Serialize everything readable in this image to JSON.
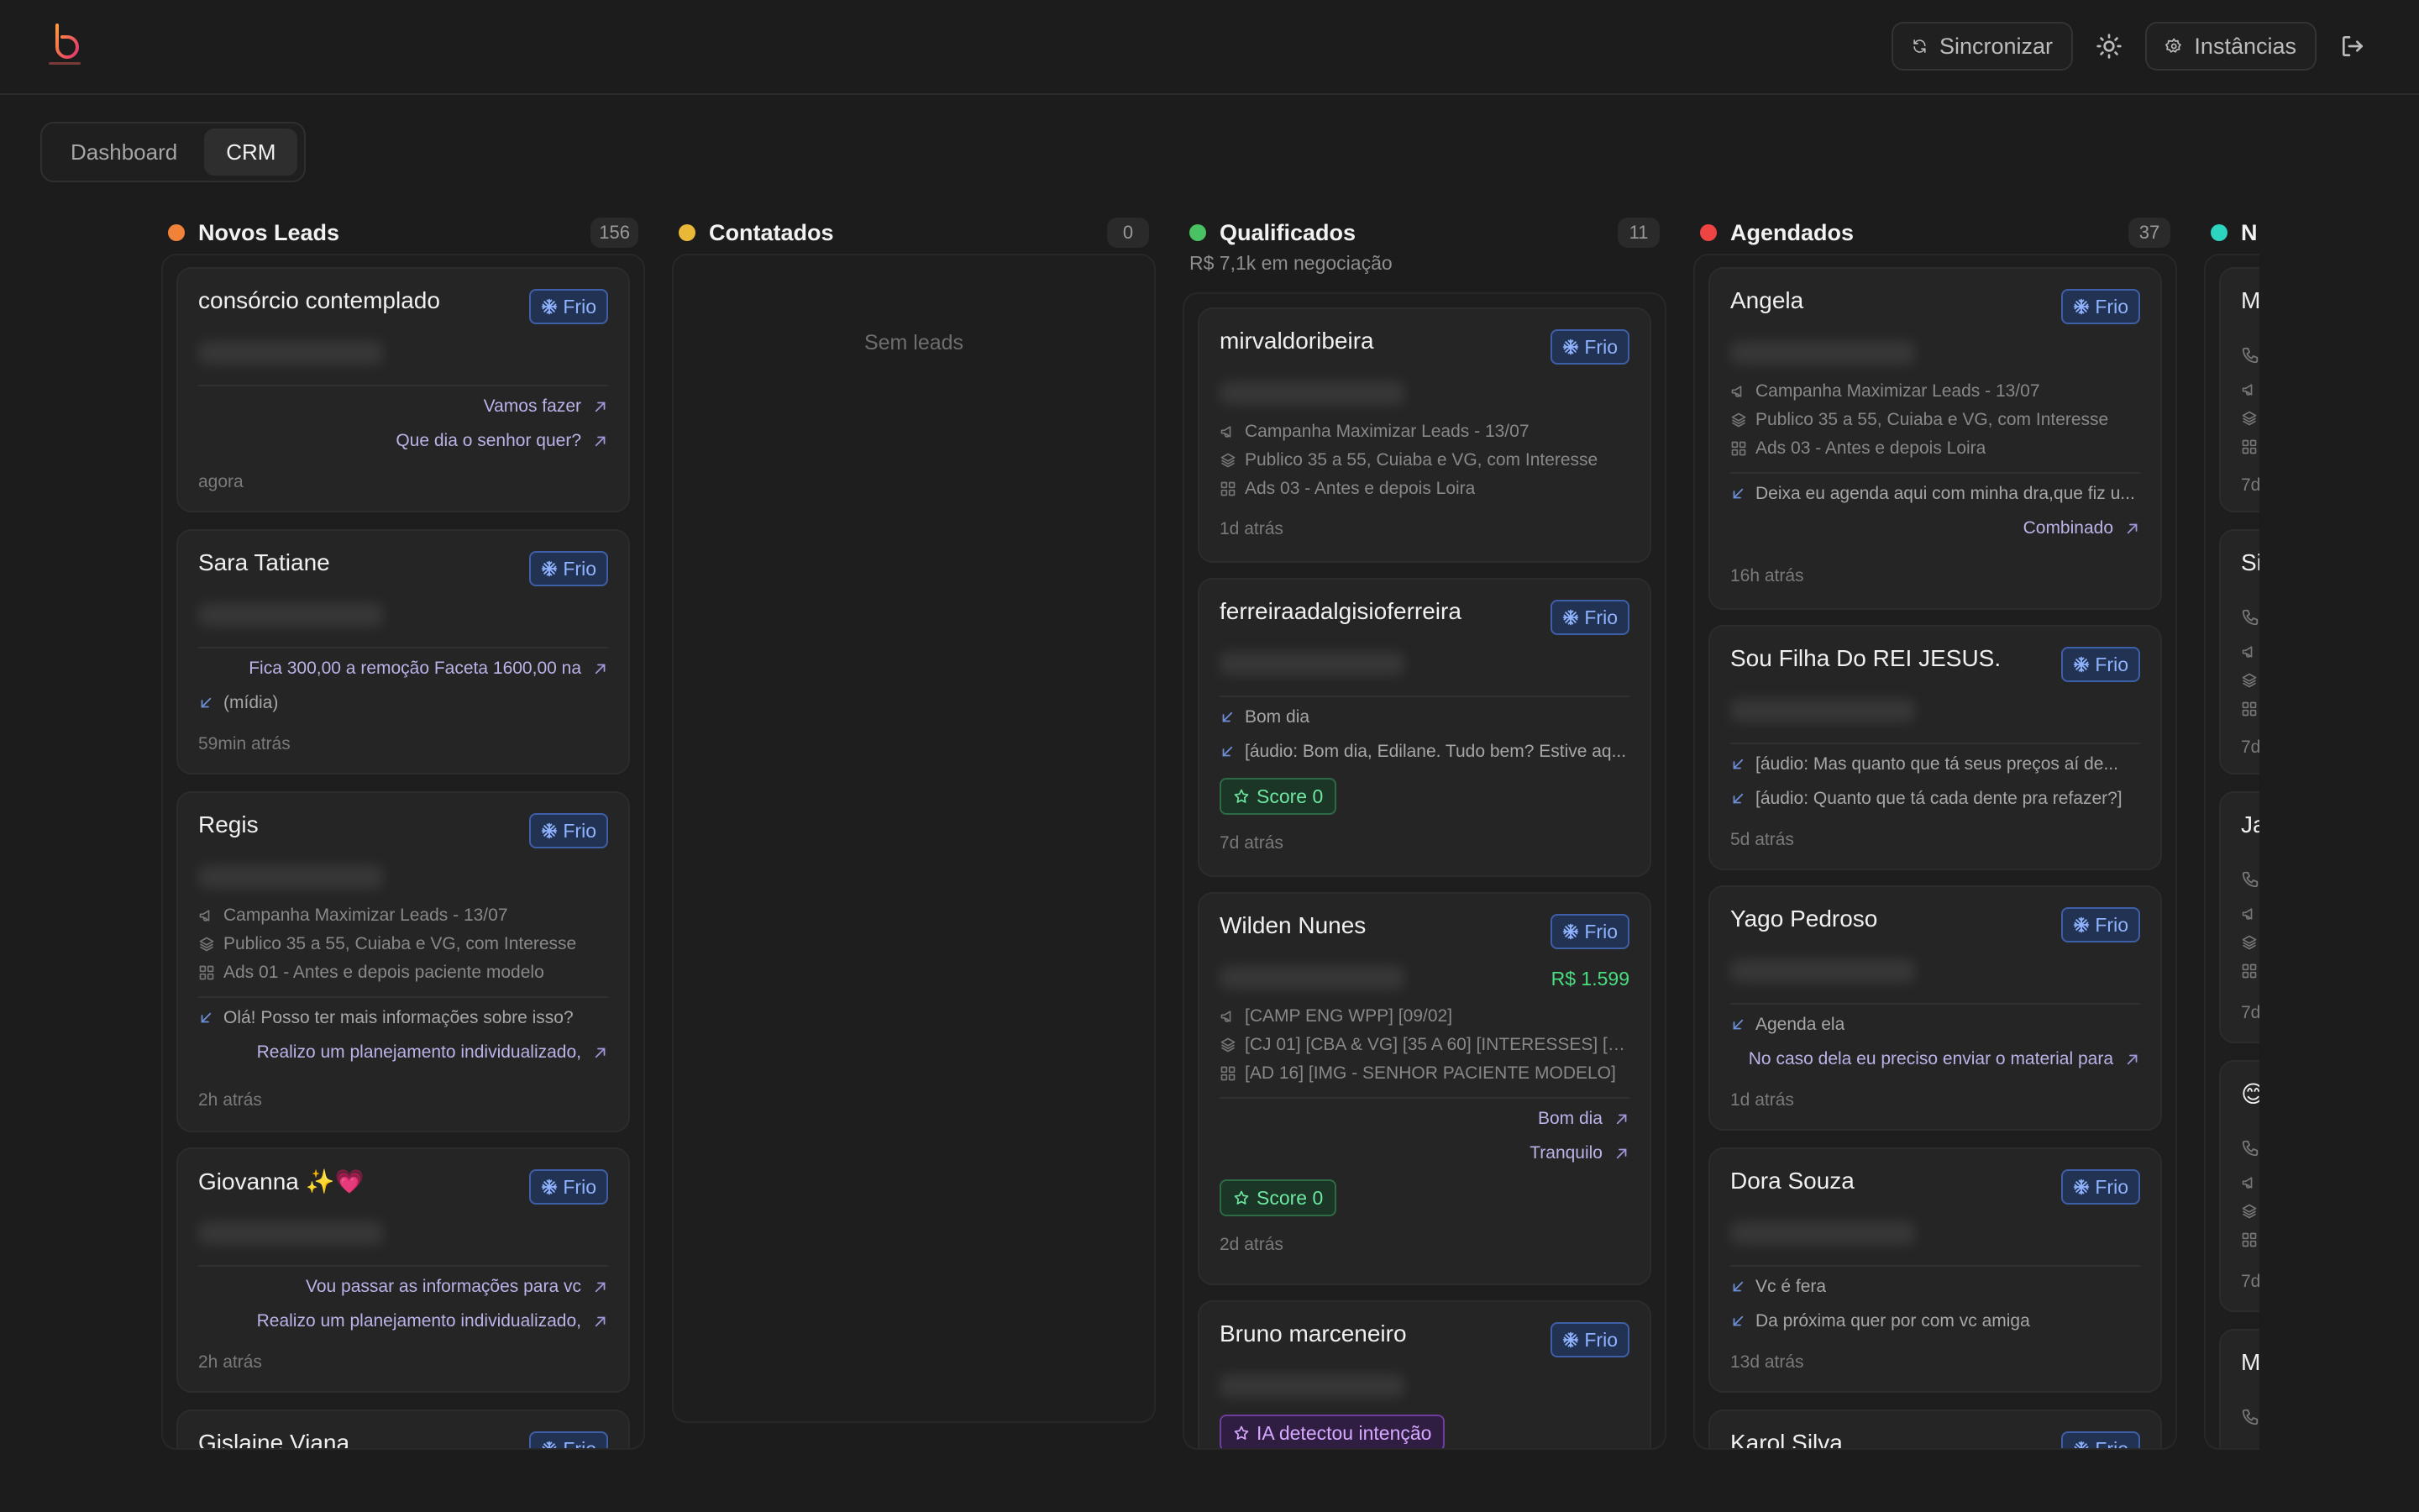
{
  "header": {
    "sync_label": "Sincronizar",
    "instances_label": "Instâncias"
  },
  "tabs": [
    {
      "label": "Dashboard",
      "active": false
    },
    {
      "label": "CRM",
      "active": true
    }
  ],
  "colors": {
    "novos": "#f0823a",
    "contatados": "#eab838",
    "qualificados": "#4ac264",
    "agendados": "#ef4444",
    "next": "#2dd4bf",
    "frio": "#8fb3ff",
    "score": "#6ee7a0",
    "ia": "#d7a8ff"
  },
  "columns": {
    "novos": {
      "title": "Novos Leads",
      "count": "156",
      "cards": [
        {
          "name": "consórcio contemplado",
          "badge": "Frio",
          "out1": "Vamos fazer",
          "out2": "Que dia o senhor quer?",
          "time": "agora"
        },
        {
          "name": "Sara Tatiane",
          "badge": "Frio",
          "out1": "Fica 300,00 a remoção Faceta 1600,00 na",
          "in1": "(mídia)",
          "time": "59min atrás"
        },
        {
          "name": "Regis",
          "badge": "Frio",
          "campaign": "Campanha Maximizar Leads - 13/07",
          "audience": "Publico 35 a 55, Cuiaba e VG, com Interesse",
          "ad": "Ads 01 - Antes e depois paciente modelo",
          "in1": "Olá! Posso ter mais informações sobre isso?",
          "out1": "Realizo um planejamento individualizado,",
          "time": "2h atrás"
        },
        {
          "name": "Giovanna ✨💗",
          "badge": "Frio",
          "out1": "Vou passar as informações para vc",
          "out2": "Realizo um planejamento individualizado,",
          "time": "2h atrás"
        },
        {
          "name": "Gislaine Viana",
          "badge": "Frio"
        }
      ]
    },
    "contatados": {
      "title": "Contatados",
      "count": "0",
      "empty": "Sem leads"
    },
    "qualificados": {
      "title": "Qualificados",
      "count": "11",
      "subtitle": "R$ 7,1k em negociação",
      "cards": [
        {
          "name": "mirvaldoribeira",
          "badge": "Frio",
          "campaign": "Campanha Maximizar Leads - 13/07",
          "audience": "Publico 35 a 55, Cuiaba e VG, com Interesse",
          "ad": "Ads 03 - Antes e depois Loira",
          "time": "1d atrás"
        },
        {
          "name": "ferreiraadalgisioferreira",
          "badge": "Frio",
          "in1": "Bom dia",
          "in2": "[áudio: Bom dia, Edilane. Tudo bem? Estive aq...",
          "score": "Score 0",
          "time": "7d atrás"
        },
        {
          "name": "Wilden Nunes",
          "badge": "Frio",
          "price": "R$ 1.599",
          "campaign": "[CAMP ENG WPP] [09/02]",
          "audience": "[CJ 01] [CBA & VG] [35 A 60] [INTERESSES] [0...",
          "ad": "[AD 16] [IMG - SENHOR PACIENTE MODELO]",
          "out1": "Bom dia",
          "out2": "Tranquilo",
          "score": "Score 0",
          "time": "2d atrás"
        },
        {
          "name": "Bruno marceneiro",
          "badge": "Frio",
          "ia": "IA detectou intenção"
        }
      ]
    },
    "agendados": {
      "title": "Agendados",
      "count": "37",
      "cards": [
        {
          "name": "Angela",
          "badge": "Frio",
          "campaign": "Campanha Maximizar Leads - 13/07",
          "audience": "Publico 35 a 55, Cuiaba e VG, com Interesse",
          "ad": "Ads 03 - Antes e depois Loira",
          "in1": "Deixa eu agenda aqui com minha dra,que fiz u...",
          "out1": "Combinado",
          "time": "16h atrás"
        },
        {
          "name": "Sou Filha Do REI JESUS.",
          "badge": "Frio",
          "in1": "[áudio: Mas quanto que tá seus preços aí de...",
          "in2": "[áudio: Quanto que tá cada dente pra refazer?]",
          "time": "5d atrás"
        },
        {
          "name": "Yago Pedroso",
          "badge": "Frio",
          "in1": "Agenda ela",
          "out1": "No caso dela eu preciso enviar o material para",
          "time": "1d atrás"
        },
        {
          "name": "Dora Souza",
          "badge": "Frio",
          "in1": "Vc é fera",
          "in2": "Da próxima quer por com vc amiga",
          "time": "13d atrás"
        },
        {
          "name": "Karol Silva",
          "badge": "Frio"
        }
      ]
    },
    "next": {
      "title": "N",
      "cards": [
        {
          "name": "M",
          "time": "7d"
        },
        {
          "name": "Si",
          "time": "7d"
        },
        {
          "name": "Ja",
          "time": "7d"
        },
        {
          "name": "😊",
          "time": "7d"
        },
        {
          "name": "M"
        }
      ]
    }
  }
}
